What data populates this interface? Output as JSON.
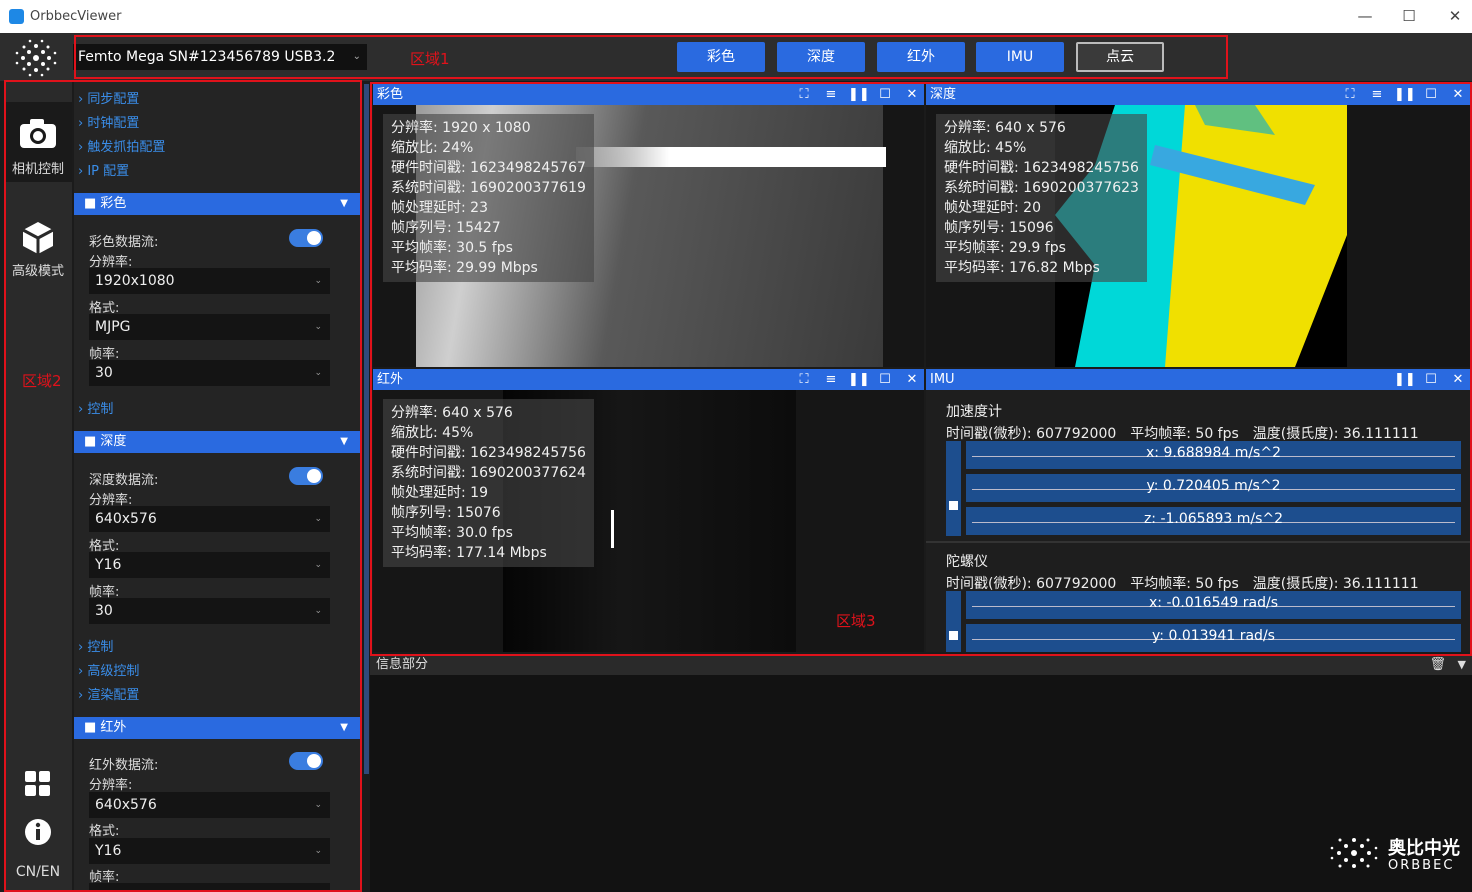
{
  "window": {
    "title": "OrbbecViewer",
    "min": "—",
    "max": "☐",
    "close": "✕"
  },
  "device": {
    "selected": "Femto Mega SN#123456789 USB3.2",
    "arrow": "⌄"
  },
  "streams": [
    "彩色",
    "深度",
    "红外",
    "IMU",
    "点云"
  ],
  "regions": {
    "r1": "区域1",
    "r2": "区域2",
    "r3": "区域3"
  },
  "rail": {
    "camera_label": "相机控制",
    "advanced_label": "高级模式",
    "lang": "CN/EN"
  },
  "left": {
    "links_top": [
      "同步配置",
      "时钟配置",
      "触发抓拍配置",
      "IP 配置"
    ],
    "color": {
      "header": "彩色",
      "stream": "彩色数据流:",
      "res_label": "分辨率:",
      "res": "1920x1080",
      "fmt_label": "格式:",
      "fmt": "MJPG",
      "fps_label": "帧率:",
      "fps": "30",
      "ctrl": "控制"
    },
    "depth": {
      "header": "深度",
      "stream": "深度数据流:",
      "res_label": "分辨率:",
      "res": "640x576",
      "fmt_label": "格式:",
      "fmt": "Y16",
      "fps_label": "帧率:",
      "fps": "30",
      "ctrl": "控制",
      "adv": "高级控制",
      "render": "渲染配置"
    },
    "ir": {
      "header": "红外",
      "stream": "红外数据流:",
      "res_label": "分辨率:",
      "res": "640x576",
      "fmt_label": "格式:",
      "fmt": "Y16",
      "fps_label": "帧率:"
    }
  },
  "panels": {
    "color": {
      "title": "彩色",
      "lines": [
        "分辨率: 1920 x 1080",
        "缩放比: 24%",
        "硬件时间戳: 1623498245767",
        "系统时间戳: 1690200377619",
        "帧处理延时: 23",
        "帧序列号: 15427",
        "平均帧率: 30.5 fps",
        "平均码率: 29.99 Mbps"
      ]
    },
    "depth": {
      "title": "深度",
      "lines": [
        "分辨率: 640 x 576",
        "缩放比: 45%",
        "硬件时间戳: 1623498245756",
        "系统时间戳: 1690200377623",
        "帧处理延时: 20",
        "帧序列号: 15096",
        "平均帧率: 29.9 fps",
        "平均码率: 176.82 Mbps"
      ]
    },
    "ir": {
      "title": "红外",
      "lines": [
        "分辨率: 640 x 576",
        "缩放比: 45%",
        "硬件时间戳: 1623498245756",
        "系统时间戳: 1690200377624",
        "帧处理延时: 19",
        "帧序列号: 15076",
        "平均帧率: 30.0 fps",
        "平均码率: 177.14 Mbps"
      ]
    },
    "imu": {
      "title": "IMU",
      "accel": {
        "name": "加速度计",
        "stats": "时间戳(微秒): 607792000　平均帧率: 50 fps　温度(摄氏度): 36.111111",
        "x": "x: 9.688984 m/s^2",
        "y": "y: 0.720405 m/s^2",
        "z": "z: -1.065893 m/s^2"
      },
      "gyro": {
        "name": "陀螺仪",
        "stats": "时间戳(微秒): 607792000　平均帧率: 50 fps　温度(摄氏度): 36.111111",
        "x": "x: -0.016549 rad/s",
        "y": "y: 0.013941 rad/s"
      }
    }
  },
  "info": {
    "title": "信息部分"
  },
  "brand": {
    "cn": "奥比中光",
    "en": "ORBBEC"
  }
}
